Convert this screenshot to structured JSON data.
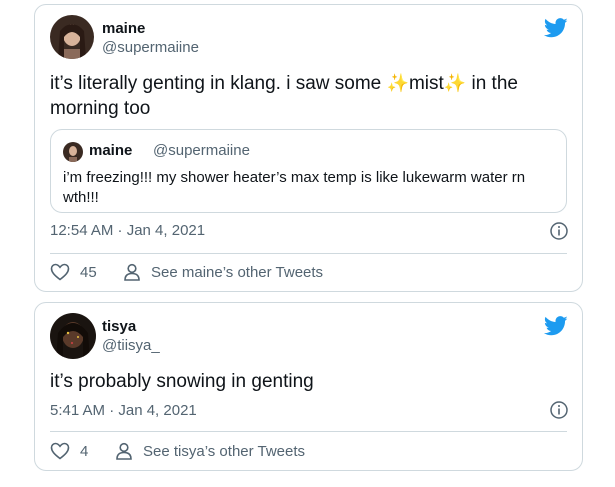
{
  "tweet1": {
    "name": "maine",
    "handle": "@supermaiine",
    "text_part1": "it’s literally genting in klang. i saw some ",
    "sparkle1": "✨",
    "text_mist": "mist",
    "sparkle2": "✨",
    "text_part2": " in the morning too",
    "timestamp": "12:54 AM · Jan 4, 2021",
    "likes": "45",
    "other_tweets_label": "See maine’s other Tweets",
    "quote": {
      "name": "maine",
      "handle": "@supermaiine",
      "text": "i’m freezing!!! my shower heater’s max temp is like lukewarm water rn wth!!!"
    }
  },
  "tweet2": {
    "name": "tisya",
    "handle": "@tiisya_",
    "text": "it’s probably snowing in genting",
    "timestamp": "5:41 AM · Jan 4, 2021",
    "likes": "4",
    "other_tweets_label": "See tisya’s other Tweets"
  },
  "colors": {
    "twitter_blue": "#1d9bf0",
    "text_primary": "#0f1419",
    "text_secondary": "#536471",
    "border": "#cfd9de"
  },
  "icons": {
    "brand": "twitter-bird-icon",
    "like": "heart-icon",
    "profile": "person-icon",
    "info": "info-icon"
  }
}
